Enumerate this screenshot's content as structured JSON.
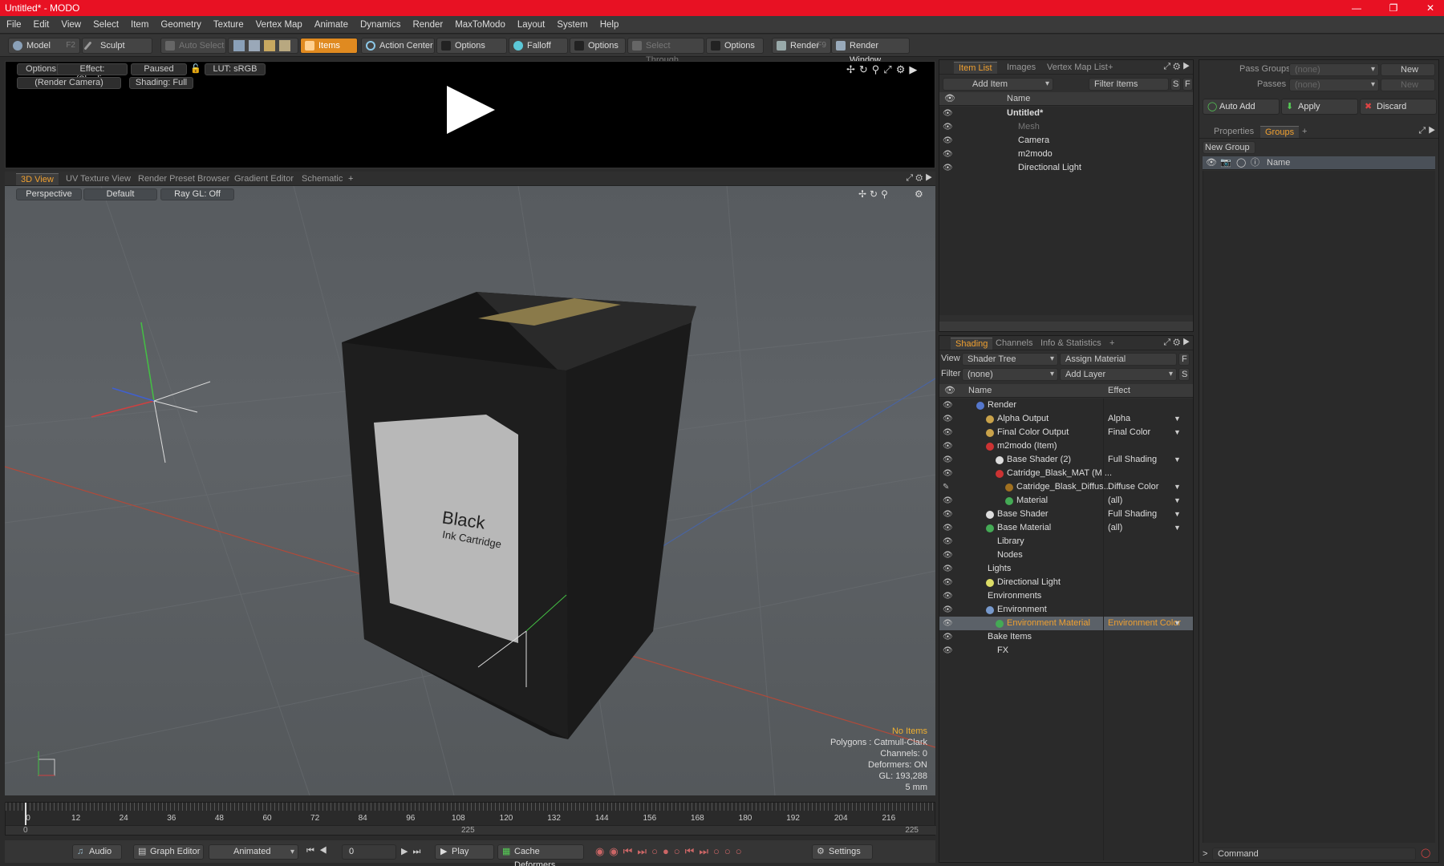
{
  "window": {
    "title": "Untitled* - MODO"
  },
  "menu": [
    "File",
    "Edit",
    "View",
    "Select",
    "Item",
    "Geometry",
    "Texture",
    "Vertex Map",
    "Animate",
    "Dynamics",
    "Render",
    "MaxToModo",
    "Layout",
    "System",
    "Help"
  ],
  "toolbar": {
    "model": "Model",
    "model_key": "F2",
    "sculpt": "Sculpt",
    "auto_select": "Auto Select",
    "items": "Items",
    "action_center": "Action Center",
    "options1": "Options",
    "falloff": "Falloff",
    "options2": "Options",
    "select_through": "Select Through",
    "options3": "Options",
    "render": "Render",
    "render_key": "F9",
    "render_window": "Render Window"
  },
  "preview": {
    "options": "Options",
    "effect": "Effect: (Shadi...",
    "paused": "Paused",
    "lut": "LUT: sRGB",
    "camera": "(Render Camera)",
    "shading": "Shading: Full"
  },
  "view_tabs": [
    "3D View",
    "UV Texture View",
    "Render Preset Browser",
    "Gradient Editor",
    "Schematic"
  ],
  "viewport": {
    "perspective": "Perspective",
    "default": "Default",
    "raygl": "Ray GL: Off",
    "label_title": "Black",
    "label_sub": "Ink Cartridge",
    "stats": [
      "No Items",
      "Polygons : Catmull-Clark",
      "Channels: 0",
      "Deformers: ON",
      "GL: 193,288",
      "5 mm"
    ]
  },
  "timeline": {
    "ticks": [
      "0",
      "12",
      "24",
      "36",
      "48",
      "60",
      "72",
      "84",
      "96",
      "108",
      "120",
      "132",
      "144",
      "156",
      "168",
      "180",
      "192",
      "204",
      "216"
    ],
    "start": "0",
    "mid": "225",
    "end": "225"
  },
  "transport": {
    "audio": "Audio",
    "graph_editor": "Graph Editor",
    "animated": "Animated",
    "frame": "0",
    "play": "Play",
    "cache_deformers": "Cache Deformers",
    "settings": "Settings"
  },
  "item_list": {
    "tabs": [
      "Item List",
      "Images",
      "Vertex Map List"
    ],
    "add_item": "Add Item",
    "filter_items": "Filter Items",
    "col_name": "Name",
    "items": [
      {
        "name": "Untitled*",
        "indent": 0
      },
      {
        "name": "Mesh",
        "indent": 1
      },
      {
        "name": "Camera",
        "indent": 1
      },
      {
        "name": "m2modo",
        "indent": 1
      },
      {
        "name": "Directional Light",
        "indent": 1
      }
    ]
  },
  "shading": {
    "tabs": [
      "Shading",
      "Channels",
      "Info & Statistics"
    ],
    "view_label": "View",
    "view_value": "Shader Tree",
    "assign_material": "Assign Material",
    "filter_label": "Filter",
    "filter_value": "(none)",
    "add_layer": "Add Layer",
    "col_name": "Name",
    "col_effect": "Effect",
    "rows": [
      {
        "name": "Render",
        "effect": "",
        "indent": 0,
        "color": "#5577cc"
      },
      {
        "name": "Alpha Output",
        "effect": "Alpha",
        "indent": 1,
        "color": "#c9a24a"
      },
      {
        "name": "Final Color Output",
        "effect": "Final Color",
        "indent": 1,
        "color": "#c9a24a"
      },
      {
        "name": "m2modo (Item)",
        "effect": "",
        "indent": 1,
        "color": "#cc3333"
      },
      {
        "name": "Base Shader (2)",
        "effect": "Full Shading",
        "indent": 2,
        "color": "#dddddd"
      },
      {
        "name": "Catridge_Blask_MAT (M ...",
        "effect": "",
        "indent": 2,
        "color": "#cc3333"
      },
      {
        "name": "Catridge_Blask_Diffus...",
        "effect": "Diffuse Color",
        "indent": 3,
        "color": "#a07020"
      },
      {
        "name": "Material",
        "effect": "(all)",
        "indent": 3,
        "color": "#44aa55"
      },
      {
        "name": "Base Shader",
        "effect": "Full Shading",
        "indent": 1,
        "color": "#dddddd"
      },
      {
        "name": "Base Material",
        "effect": "(all)",
        "indent": 1,
        "color": "#44aa55"
      },
      {
        "name": "Library",
        "effect": "",
        "indent": 1,
        "color": ""
      },
      {
        "name": "Nodes",
        "effect": "",
        "indent": 1,
        "color": ""
      },
      {
        "name": "Lights",
        "effect": "",
        "indent": 0,
        "color": ""
      },
      {
        "name": "Directional Light",
        "effect": "",
        "indent": 1,
        "color": "#dddd66"
      },
      {
        "name": "Environments",
        "effect": "",
        "indent": 0,
        "color": ""
      },
      {
        "name": "Environment",
        "effect": "",
        "indent": 1,
        "color": "#7799cc"
      },
      {
        "name": "Environment Material",
        "effect": "Environment Color",
        "indent": 2,
        "color": "#44aa55"
      },
      {
        "name": "Bake Items",
        "effect": "",
        "indent": 0,
        "color": ""
      },
      {
        "name": "FX",
        "effect": "",
        "indent": 1,
        "color": ""
      }
    ]
  },
  "groups": {
    "pass_groups": "Pass Groups",
    "pass_value": "(none)",
    "new1": "New",
    "passes": "Passes",
    "passes_value": "(none)",
    "new2": "New",
    "auto_add": "Auto Add",
    "apply": "Apply",
    "discard": "Discard",
    "tabs": [
      "Properties",
      "Groups"
    ],
    "new_group": "New Group",
    "col_name": "Name",
    "command": "Command"
  }
}
